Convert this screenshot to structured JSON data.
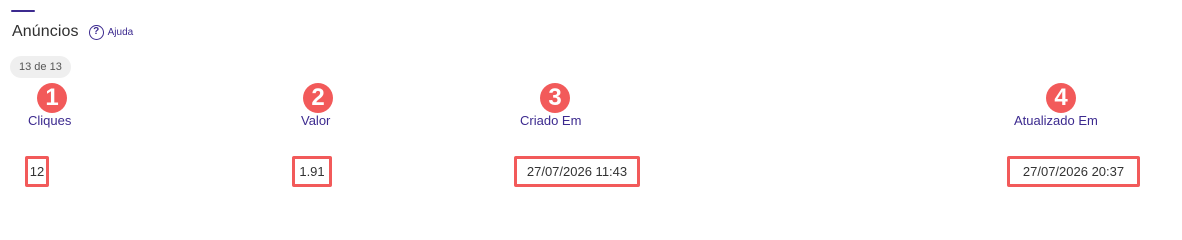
{
  "section": {
    "title": "Anúncios",
    "help_label": "Ajuda",
    "count_label": "13 de 13"
  },
  "markers": [
    "1",
    "2",
    "3",
    "4"
  ],
  "table": {
    "columns": [
      "Cliques",
      "Valor",
      "Criado Em",
      "Atualizado Em"
    ],
    "row": [
      "12",
      "1.91",
      "27/07/2026 11:43",
      "27/07/2026 20:37"
    ]
  },
  "colors": {
    "accent": "#3c2a8f",
    "highlight": "#f25a5a"
  }
}
